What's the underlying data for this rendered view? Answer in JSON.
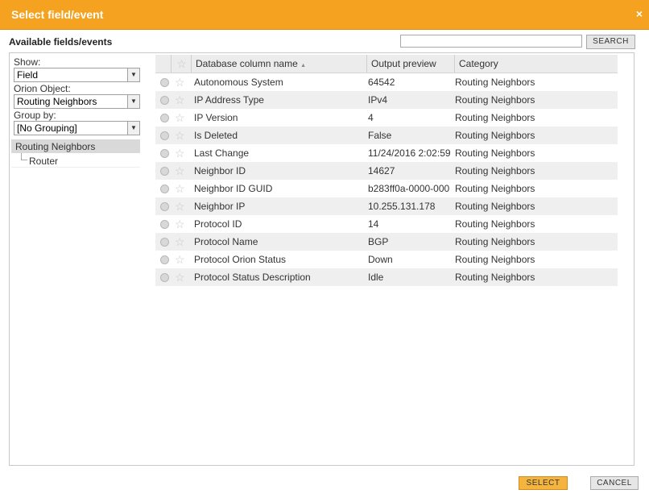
{
  "dialog": {
    "title": "Select field/event",
    "close_glyph": "×"
  },
  "available_label": "Available fields/events",
  "search": {
    "value": "",
    "button_label": "SEARCH"
  },
  "filters": {
    "show_label": "Show:",
    "show_value": "Field",
    "object_label": "Orion Object:",
    "object_value": "Routing Neighbors",
    "group_label": "Group by:",
    "group_value": "[No Grouping]"
  },
  "tree": {
    "root": "Routing Neighbors",
    "child": "Router"
  },
  "grid": {
    "columns": {
      "name": "Database column name",
      "sort_glyph": "▲",
      "preview": "Output preview",
      "category": "Category"
    },
    "rows": [
      {
        "name": "Autonomous System",
        "preview": "64542",
        "category": "Routing Neighbors"
      },
      {
        "name": "IP Address Type",
        "preview": "IPv4",
        "category": "Routing Neighbors"
      },
      {
        "name": "IP Version",
        "preview": "4",
        "category": "Routing Neighbors"
      },
      {
        "name": "Is Deleted",
        "preview": "False",
        "category": "Routing Neighbors"
      },
      {
        "name": "Last Change",
        "preview": "11/24/2016 2:02:59",
        "category": "Routing Neighbors"
      },
      {
        "name": "Neighbor ID",
        "preview": "14627",
        "category": "Routing Neighbors"
      },
      {
        "name": "Neighbor ID GUID",
        "preview": "b283ff0a-0000-000",
        "category": "Routing Neighbors"
      },
      {
        "name": "Neighbor IP",
        "preview": "10.255.131.178",
        "category": "Routing Neighbors"
      },
      {
        "name": "Protocol ID",
        "preview": "14",
        "category": "Routing Neighbors"
      },
      {
        "name": "Protocol Name",
        "preview": "BGP",
        "category": "Routing Neighbors"
      },
      {
        "name": "Protocol Orion Status",
        "preview": "Down",
        "category": "Routing Neighbors"
      },
      {
        "name": "Protocol Status Description",
        "preview": "Idle",
        "category": "Routing Neighbors"
      }
    ]
  },
  "footer": {
    "select_label": "SELECT",
    "cancel_label": "CANCEL"
  },
  "colors": {
    "title_bar": "#f4a21f",
    "select_button": "#f4b43e"
  }
}
